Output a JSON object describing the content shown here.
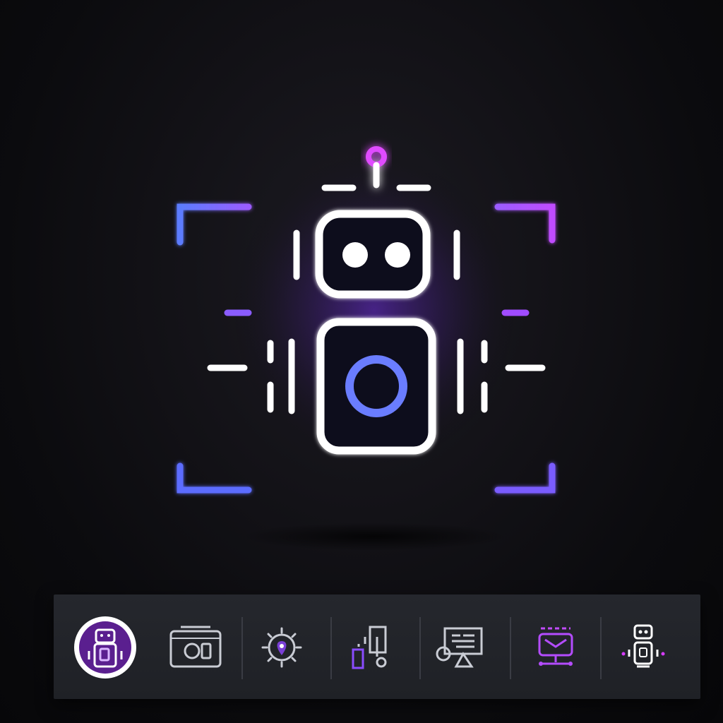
{
  "hero": {
    "icon": "robot-scan-icon",
    "colors": {
      "outline": "#ffffff",
      "magenta": "#d63cff",
      "violet": "#9b5cff",
      "blue": "#5b7cff"
    }
  },
  "toolbar": {
    "items": [
      {
        "icon": "robot-badge-icon",
        "active": true
      },
      {
        "icon": "camera-icon",
        "active": false
      },
      {
        "icon": "gear-pin-icon",
        "active": false
      },
      {
        "icon": "device-connect-icon",
        "active": false
      },
      {
        "icon": "monitor-stand-icon",
        "active": false
      },
      {
        "icon": "robot-head-icon",
        "active": false
      },
      {
        "icon": "robot-small-icon",
        "active": false
      }
    ]
  }
}
